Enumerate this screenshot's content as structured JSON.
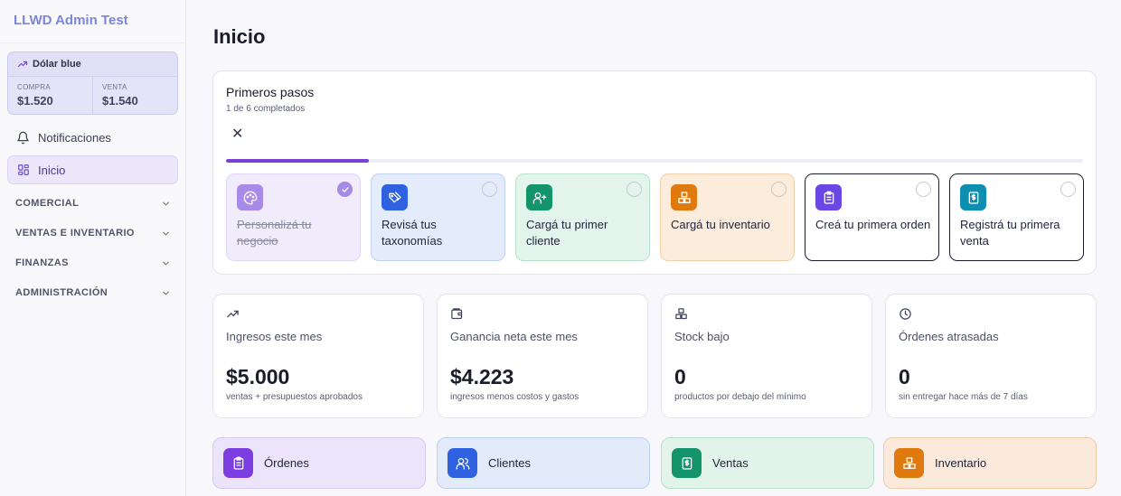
{
  "sidebar": {
    "brand": "LLWD Admin Test",
    "dolar": {
      "title": "Dólar blue",
      "compra_label": "COMPRA",
      "compra_value": "$1.520",
      "venta_label": "VENTA",
      "venta_value": "$1.540"
    },
    "notifications": "Notificaciones",
    "inicio": "Inicio",
    "sections": [
      "COMERCIAL",
      "VENTAS E INVENTARIO",
      "FINANZAS",
      "ADMINISTRACIÓN"
    ]
  },
  "main": {
    "title": "Inicio",
    "steps": {
      "title": "Primeros pasos",
      "subtitle": "1 de 6 completados",
      "close_glyph": "✕",
      "progress": 0.167,
      "items": [
        {
          "label": "Personalizá tu negocio",
          "icon": "palette-icon",
          "done": true,
          "bg": "#f1ecfc",
          "border": "#e0d6f7",
          "icon_bg": "#a88ae8"
        },
        {
          "label": "Revisá tus taxonomías",
          "icon": "tags-icon",
          "done": false,
          "bg": "#e4ecfc",
          "border": "#bfd0f4",
          "icon_bg": "#2f62e0"
        },
        {
          "label": "Cargá tu primer cliente",
          "icon": "user-plus-icon",
          "done": false,
          "bg": "#e3f4ec",
          "border": "#b8e2cc",
          "icon_bg": "#14946a"
        },
        {
          "label": "Cargá tu inventario",
          "icon": "boxes-icon",
          "done": false,
          "bg": "#fcecdc",
          "border": "#f2cfa8",
          "icon_bg": "#e0790e"
        },
        {
          "label": "Creá tu primera orden",
          "icon": "clipboard-icon",
          "done": false,
          "bg": "#ffffff",
          "border": "#1a1d29",
          "icon_bg": "#6b48e6"
        },
        {
          "label": "Registrá tu primera venta",
          "icon": "receipt-icon",
          "done": false,
          "bg": "#ffffff",
          "border": "#1a1d29",
          "icon_bg": "#0f8fb0"
        }
      ]
    },
    "stats": [
      {
        "label": "Ingresos este mes",
        "value": "$5.000",
        "sub": "ventas + presupuestos aprobados",
        "icon": "trending-up-icon"
      },
      {
        "label": "Ganancia neta este mes",
        "value": "$4.223",
        "sub": "ingresos menos costos y gastos",
        "icon": "wallet-icon"
      },
      {
        "label": "Stock bajo",
        "value": "0",
        "sub": "productos por debajo del mínimo",
        "icon": "boxes-icon"
      },
      {
        "label": "Órdenes atrasadas",
        "value": "0",
        "sub": "sin entregar hace más de 7 días",
        "icon": "clock-icon"
      }
    ],
    "quick": [
      {
        "label": "Órdenes",
        "icon": "clipboard-icon",
        "bg": "#ece4fa",
        "border": "#d6c7f4",
        "icon_bg": "#7c3ee0"
      },
      {
        "label": "Clientes",
        "icon": "users-icon",
        "bg": "#e3ebfb",
        "border": "#bfd0f2",
        "icon_bg": "#2f62e0"
      },
      {
        "label": "Ventas",
        "icon": "receipt-icon",
        "bg": "#e2f3ea",
        "border": "#b8e0c9",
        "icon_bg": "#14946a"
      },
      {
        "label": "Inventario",
        "icon": "boxes-icon",
        "bg": "#fbeadc",
        "border": "#f0cba6",
        "icon_bg": "#e0790e"
      }
    ]
  }
}
